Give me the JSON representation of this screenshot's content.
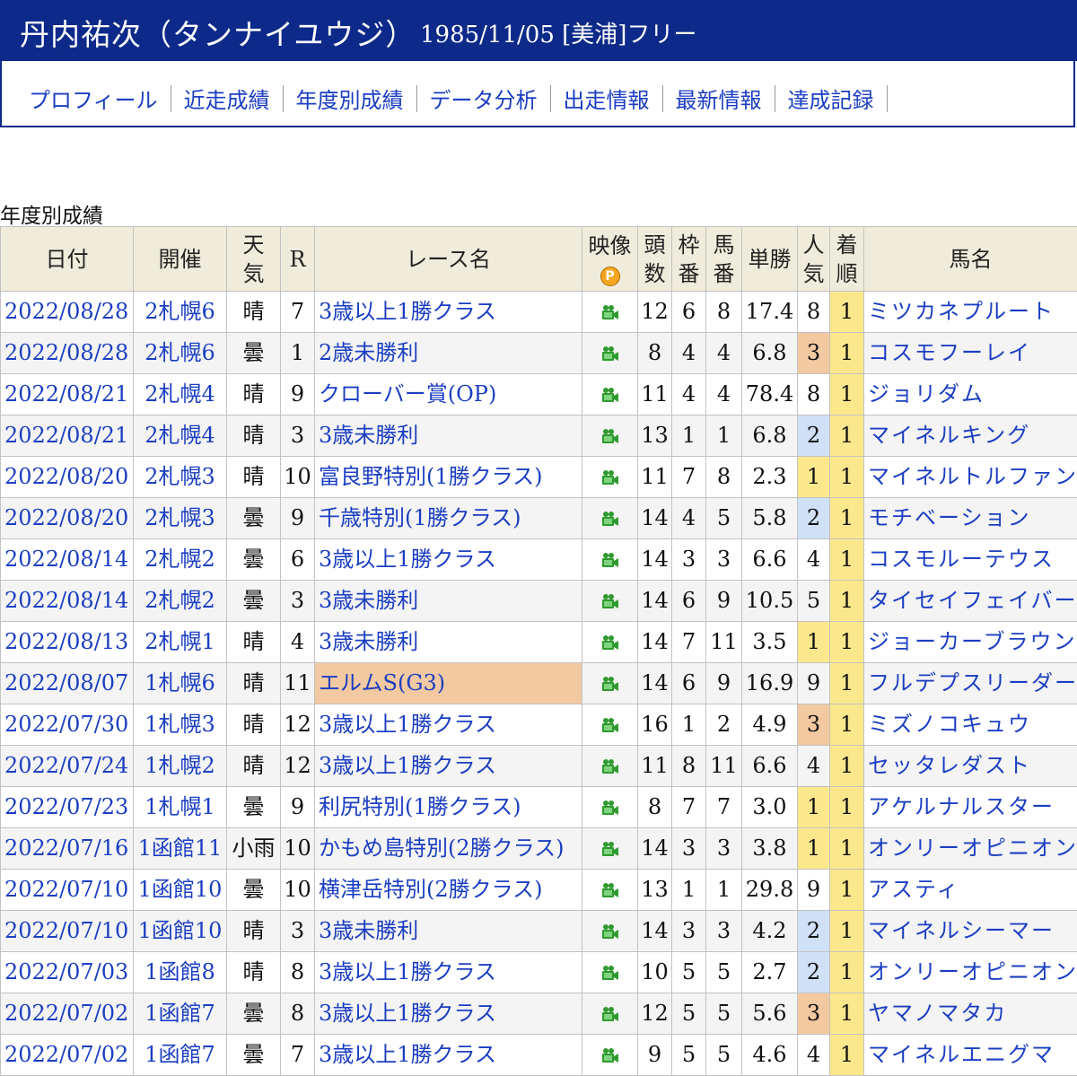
{
  "header": {
    "name": "丹内祐次（タンナイユウジ）",
    "info": "1985/11/05 [美浦]フリー"
  },
  "nav": [
    "プロフィール",
    "近走成績",
    "年度別成績",
    "データ分析",
    "出走情報",
    "最新情報",
    "達成記録"
  ],
  "section_title": "年度別成績",
  "columns": {
    "date": "日付",
    "venue": "開催",
    "weather": "天気",
    "race_no": "R",
    "race_name": "レース名",
    "video": "映像",
    "video_badge": "P",
    "field": "頭数",
    "frame": "枠番",
    "horse_no": "馬番",
    "odds": "単勝",
    "popularity": "人気",
    "place": "着順",
    "horse": "馬名"
  },
  "colors": {
    "header_bg": "#0d2a8a",
    "link": "#1b3ec2",
    "th_bg": "#efecdb",
    "pop1": "#fbe88c",
    "pop2": "#cfe0f7",
    "pop3": "#f2c9a0",
    "video_icon": "#2e9a2e"
  },
  "rows": [
    {
      "date": "2022/08/28",
      "venue": "2札幌6",
      "weather": "晴",
      "race_no": "7",
      "race_name": "3歳以上1勝クラス",
      "video_icon": "video-camera-icon",
      "field": "12",
      "frame": "6",
      "horse_no": "8",
      "odds": "17.4",
      "popularity": "8",
      "place": "1",
      "horse": "ミツカネプルート",
      "grade": ""
    },
    {
      "date": "2022/08/28",
      "venue": "2札幌6",
      "weather": "曇",
      "race_no": "1",
      "race_name": "2歳未勝利",
      "video_icon": "video-camera-icon",
      "field": "8",
      "frame": "4",
      "horse_no": "4",
      "odds": "6.8",
      "popularity": "3",
      "place": "1",
      "horse": "コスモフーレイ",
      "grade": ""
    },
    {
      "date": "2022/08/21",
      "venue": "2札幌4",
      "weather": "晴",
      "race_no": "9",
      "race_name": "クローバー賞(OP)",
      "video_icon": "video-camera-icon",
      "field": "11",
      "frame": "4",
      "horse_no": "4",
      "odds": "78.4",
      "popularity": "8",
      "place": "1",
      "horse": "ジョリダム",
      "grade": ""
    },
    {
      "date": "2022/08/21",
      "venue": "2札幌4",
      "weather": "晴",
      "race_no": "3",
      "race_name": "3歳未勝利",
      "video_icon": "video-camera-icon",
      "field": "13",
      "frame": "1",
      "horse_no": "1",
      "odds": "6.8",
      "popularity": "2",
      "place": "1",
      "horse": "マイネルキング",
      "grade": ""
    },
    {
      "date": "2022/08/20",
      "venue": "2札幌3",
      "weather": "晴",
      "race_no": "10",
      "race_name": "富良野特別(1勝クラス)",
      "video_icon": "video-camera-icon",
      "field": "11",
      "frame": "7",
      "horse_no": "8",
      "odds": "2.3",
      "popularity": "1",
      "place": "1",
      "horse": "マイネルトルファン",
      "grade": ""
    },
    {
      "date": "2022/08/20",
      "venue": "2札幌3",
      "weather": "曇",
      "race_no": "9",
      "race_name": "千歳特別(1勝クラス)",
      "video_icon": "video-camera-icon",
      "field": "14",
      "frame": "4",
      "horse_no": "5",
      "odds": "5.8",
      "popularity": "2",
      "place": "1",
      "horse": "モチベーション",
      "grade": ""
    },
    {
      "date": "2022/08/14",
      "venue": "2札幌2",
      "weather": "曇",
      "race_no": "6",
      "race_name": "3歳以上1勝クラス",
      "video_icon": "video-camera-icon",
      "field": "14",
      "frame": "3",
      "horse_no": "3",
      "odds": "6.6",
      "popularity": "4",
      "place": "1",
      "horse": "コスモルーテウス",
      "grade": ""
    },
    {
      "date": "2022/08/14",
      "venue": "2札幌2",
      "weather": "曇",
      "race_no": "3",
      "race_name": "3歳未勝利",
      "video_icon": "video-camera-icon",
      "field": "14",
      "frame": "6",
      "horse_no": "9",
      "odds": "10.5",
      "popularity": "5",
      "place": "1",
      "horse": "タイセイフェイバー",
      "grade": ""
    },
    {
      "date": "2022/08/13",
      "venue": "2札幌1",
      "weather": "晴",
      "race_no": "4",
      "race_name": "3歳未勝利",
      "video_icon": "video-camera-icon",
      "field": "14",
      "frame": "7",
      "horse_no": "11",
      "odds": "3.5",
      "popularity": "1",
      "place": "1",
      "horse": "ジョーカーブラウン",
      "grade": ""
    },
    {
      "date": "2022/08/07",
      "venue": "1札幌6",
      "weather": "晴",
      "race_no": "11",
      "race_name": "エルムS(G3)",
      "video_icon": "video-camera-icon",
      "field": "14",
      "frame": "6",
      "horse_no": "9",
      "odds": "16.9",
      "popularity": "9",
      "place": "1",
      "horse": "フルデプスリーダー",
      "grade": "G3"
    },
    {
      "date": "2022/07/30",
      "venue": "1札幌3",
      "weather": "晴",
      "race_no": "12",
      "race_name": "3歳以上1勝クラス",
      "video_icon": "video-camera-icon",
      "field": "16",
      "frame": "1",
      "horse_no": "2",
      "odds": "4.9",
      "popularity": "3",
      "place": "1",
      "horse": "ミズノコキュウ",
      "grade": ""
    },
    {
      "date": "2022/07/24",
      "venue": "1札幌2",
      "weather": "晴",
      "race_no": "12",
      "race_name": "3歳以上1勝クラス",
      "video_icon": "video-camera-icon",
      "field": "11",
      "frame": "8",
      "horse_no": "11",
      "odds": "6.6",
      "popularity": "4",
      "place": "1",
      "horse": "セッタレダスト",
      "grade": ""
    },
    {
      "date": "2022/07/23",
      "venue": "1札幌1",
      "weather": "曇",
      "race_no": "9",
      "race_name": "利尻特別(1勝クラス)",
      "video_icon": "video-camera-icon",
      "field": "8",
      "frame": "7",
      "horse_no": "7",
      "odds": "3.0",
      "popularity": "1",
      "place": "1",
      "horse": "アケルナルスター",
      "grade": ""
    },
    {
      "date": "2022/07/16",
      "venue": "1函館11",
      "weather": "小雨",
      "race_no": "10",
      "race_name": "かもめ島特別(2勝クラス)",
      "video_icon": "video-camera-icon",
      "field": "14",
      "frame": "3",
      "horse_no": "3",
      "odds": "3.8",
      "popularity": "1",
      "place": "1",
      "horse": "オンリーオピニオン",
      "grade": ""
    },
    {
      "date": "2022/07/10",
      "venue": "1函館10",
      "weather": "曇",
      "race_no": "10",
      "race_name": "横津岳特別(2勝クラス)",
      "video_icon": "video-camera-icon",
      "field": "13",
      "frame": "1",
      "horse_no": "1",
      "odds": "29.8",
      "popularity": "9",
      "place": "1",
      "horse": "アスティ",
      "grade": ""
    },
    {
      "date": "2022/07/10",
      "venue": "1函館10",
      "weather": "晴",
      "race_no": "3",
      "race_name": "3歳未勝利",
      "video_icon": "video-camera-icon",
      "field": "14",
      "frame": "3",
      "horse_no": "3",
      "odds": "4.2",
      "popularity": "2",
      "place": "1",
      "horse": "マイネルシーマー",
      "grade": ""
    },
    {
      "date": "2022/07/03",
      "venue": "1函館8",
      "weather": "晴",
      "race_no": "8",
      "race_name": "3歳以上1勝クラス",
      "video_icon": "video-camera-icon",
      "field": "10",
      "frame": "5",
      "horse_no": "5",
      "odds": "2.7",
      "popularity": "2",
      "place": "1",
      "horse": "オンリーオピニオン",
      "grade": ""
    },
    {
      "date": "2022/07/02",
      "venue": "1函館7",
      "weather": "曇",
      "race_no": "8",
      "race_name": "3歳以上1勝クラス",
      "video_icon": "video-camera-icon",
      "field": "12",
      "frame": "5",
      "horse_no": "5",
      "odds": "5.6",
      "popularity": "3",
      "place": "1",
      "horse": "ヤマノマタカ",
      "grade": ""
    },
    {
      "date": "2022/07/02",
      "venue": "1函館7",
      "weather": "曇",
      "race_no": "7",
      "race_name": "3歳以上1勝クラス",
      "video_icon": "video-camera-icon",
      "field": "9",
      "frame": "5",
      "horse_no": "5",
      "odds": "4.6",
      "popularity": "4",
      "place": "1",
      "horse": "マイネルエニグマ",
      "grade": ""
    }
  ]
}
